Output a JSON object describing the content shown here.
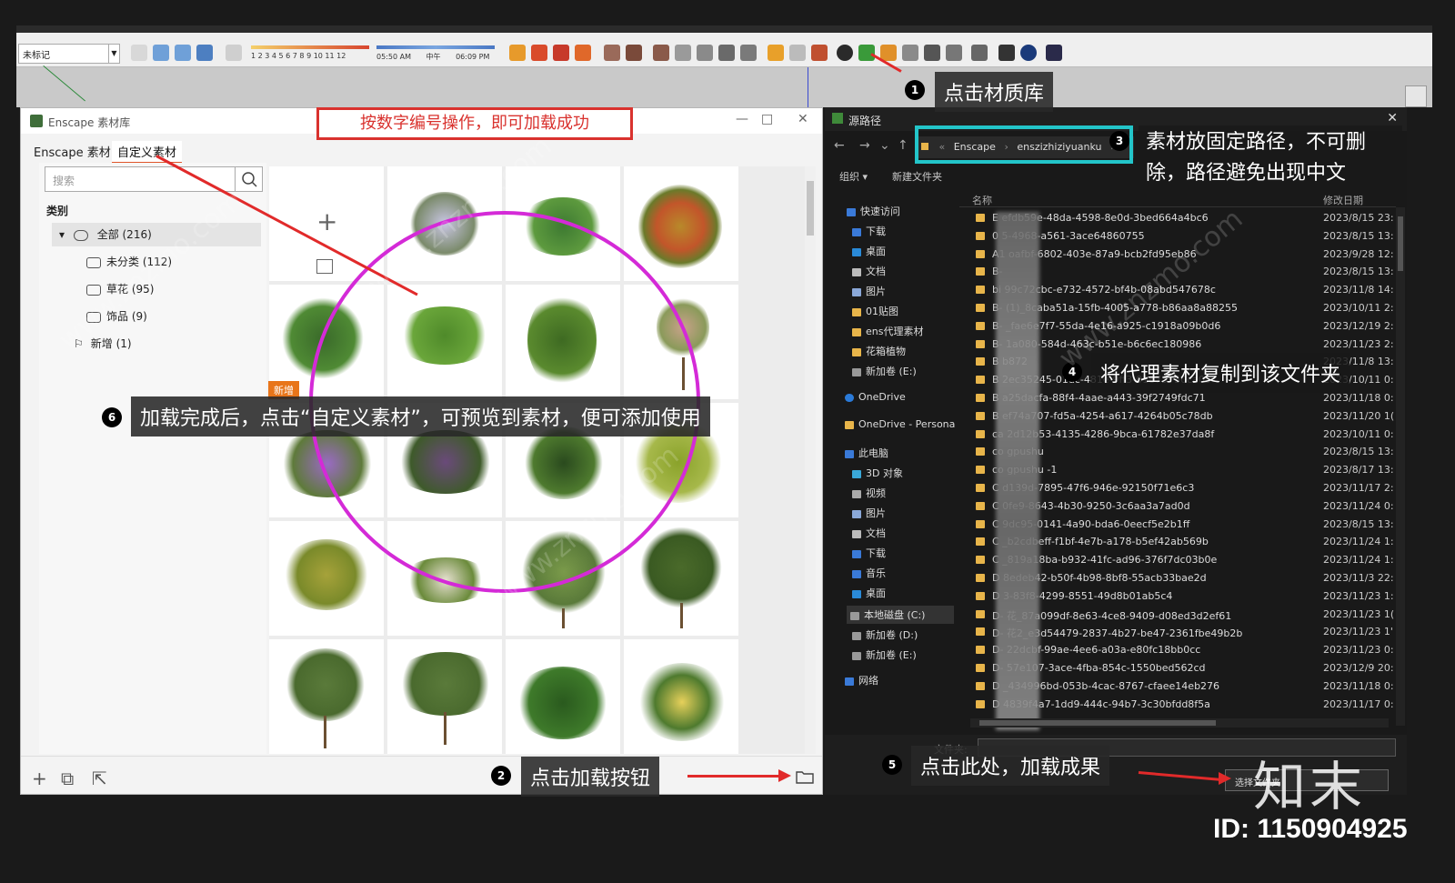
{
  "toolbar": {
    "layer_value": "未标记",
    "scale_numbers": "1 2 3 4 5 6 7 8 9 10 11 12",
    "time_start": "05:50 AM",
    "time_mid": "中午",
    "time_end": "06:09 PM"
  },
  "enscape": {
    "title": "Enscape 素材库",
    "tabs": [
      "Enscape 素材",
      "自定义素材"
    ],
    "search_placeholder": "搜索",
    "category_title": "类别",
    "categories": [
      {
        "label": "全部 (216)"
      },
      {
        "label": "未分类 (112)"
      },
      {
        "label": "草花 (95)"
      },
      {
        "label": "饰品 (9)"
      },
      {
        "label": "新增 (1)"
      }
    ],
    "new_badge": "新增"
  },
  "explorer": {
    "title": "源路径",
    "address": [
      "Enscape",
      "enszizhiziyuanku"
    ],
    "commands": [
      "组织 ▾",
      "新建文件夹"
    ],
    "col_name": "名称",
    "col_date": "修改日期",
    "sidebar": [
      "快速访问",
      "下载",
      "桌面",
      "文档",
      "图片",
      "01贴图",
      "ens代理素材",
      "花箱植物",
      "新加卷 (E:)",
      "OneDrive",
      "OneDrive - Persona",
      "此电脑",
      "3D 对象",
      "视频",
      "图片",
      "文档",
      "下载",
      "音乐",
      "桌面",
      "本地磁盘 (C:)",
      "新加卷 (D:)",
      "新加卷 (E:)",
      "网络"
    ],
    "rows": [
      {
        "name": "E            efdb59e-48da-4598-8e0d-3bed664a4bc6",
        "date": "2023/8/15 23:"
      },
      {
        "name": "0            5-4968-a561-3ace64860755",
        "date": "2023/8/15 13:"
      },
      {
        "name": "A1           oafbf-6802-403e-87a9-bcb2fd95eb86",
        "date": "2023/9/28 12:"
      },
      {
        "name": "B-",
        "date": "2023/8/15 13:"
      },
      {
        "name": "bi           99c72cbc-e732-4572-bf4b-08abd547678c",
        "date": "2023/11/8 14:"
      },
      {
        "name": "B-          (1)_8caba51a-15fb-4005-a778-b86aa8a88255",
        "date": "2023/10/11 2:"
      },
      {
        "name": "B-           _fae6e7f7-55da-4e16-a925-c1918a09b0d6",
        "date": "2023/12/19 2:"
      },
      {
        "name": "B-           1a080-584d-463c-b51e-b6c6ec180986",
        "date": "2023/11/23 2:"
      },
      {
        "name": "B            b872",
        "date": "2023/11/8 13:"
      },
      {
        "name": "B            2ec35245-01dc-481e-9ff3-01873750ca05",
        "date": "2023/10/11 0:"
      },
      {
        "name": "B            a25dacfa-88f4-4aae-a443-39f2749fdc71",
        "date": "2023/11/18 0:"
      },
      {
        "name": "B            ef74a707-fd5a-4254-a617-4264b05c78db",
        "date": "2023/11/20 1("
      },
      {
        "name": "ca           2d12b53-4135-4286-9bca-61782e37da8f",
        "date": "2023/10/11 0:"
      },
      {
        "name": "co           gpushu",
        "date": "2023/8/15 13:"
      },
      {
        "name": "co           gpushu -1",
        "date": "2023/8/17 13:"
      },
      {
        "name": "C            d139d-7895-47f6-946e-92150f71e6c3",
        "date": "2023/11/17 2:"
      },
      {
        "name": "C            0fe9-8643-4b30-9250-3c6aa3a7ad0d",
        "date": "2023/11/24 0:"
      },
      {
        "name": "C            9dc95-0141-4a90-bda6-0eecf5e2b1ff",
        "date": "2023/8/15 13:"
      },
      {
        "name": "C            _b2cdbeff-f1bf-4e7b-a178-b5ef42ab569b",
        "date": "2023/11/24 1:"
      },
      {
        "name": "C            _819a18ba-b932-41fc-ad96-376f7dc03b0e",
        "date": "2023/11/24 1:"
      },
      {
        "name": "D            8edeb42-b50f-4b98-8bf8-55acb33bae2d",
        "date": "2023/11/3 22:"
      },
      {
        "name": "D            3-83f8-4299-8551-49d8b01ab5c4",
        "date": "2023/11/23 1:"
      },
      {
        "name": "D-           花_87a099df-8e63-4ce8-9409-d08ed3d2ef61",
        "date": "2023/11/23 1("
      },
      {
        "name": "D-           花2_e3d54479-2837-4b27-be47-2361fbe49b2b",
        "date": "2023/11/23 1'"
      },
      {
        "name": "D-           22dcbf-99ae-4ee6-a03a-e80fc18bb0cc",
        "date": "2023/11/23 0:"
      },
      {
        "name": "D-           57e107-3ace-4fba-854c-1550bed562cd",
        "date": "2023/12/9 20:"
      },
      {
        "name": "D            _434996bd-053b-4cac-8767-cfaee14eb276",
        "date": "2023/11/18 0:"
      },
      {
        "name": "D            4839f4a7-1dd9-444c-94b7-3c30bfdd8f5a",
        "date": "2023/11/17 0:"
      }
    ],
    "filename_label": "文件夹:",
    "select_button": "选择文件夹"
  },
  "annotations": {
    "banner": "按数字编号操作，即可加载成功",
    "step1": "点击材质库",
    "step2": "点击加载按钮",
    "step3": "素材放固定路径，不可删除，路径避免出现中文",
    "step4": "将代理素材复制到该文件夹",
    "step5": "点击此处，加载成果",
    "step6": "加载完成后，点击“自定义素材”，可预览到素材，便可添加使用",
    "nums": [
      "1",
      "2",
      "3",
      "4",
      "5",
      "6"
    ]
  },
  "watermark": {
    "site": "www.znzmo.com",
    "brand": "知末",
    "id": "ID: 1150904925"
  },
  "colors": {
    "accent_red": "#d9322e",
    "circle_magenta": "#d42ad7",
    "cyan_box": "#23c5c9",
    "folder_yellow": "#e8b54a"
  }
}
